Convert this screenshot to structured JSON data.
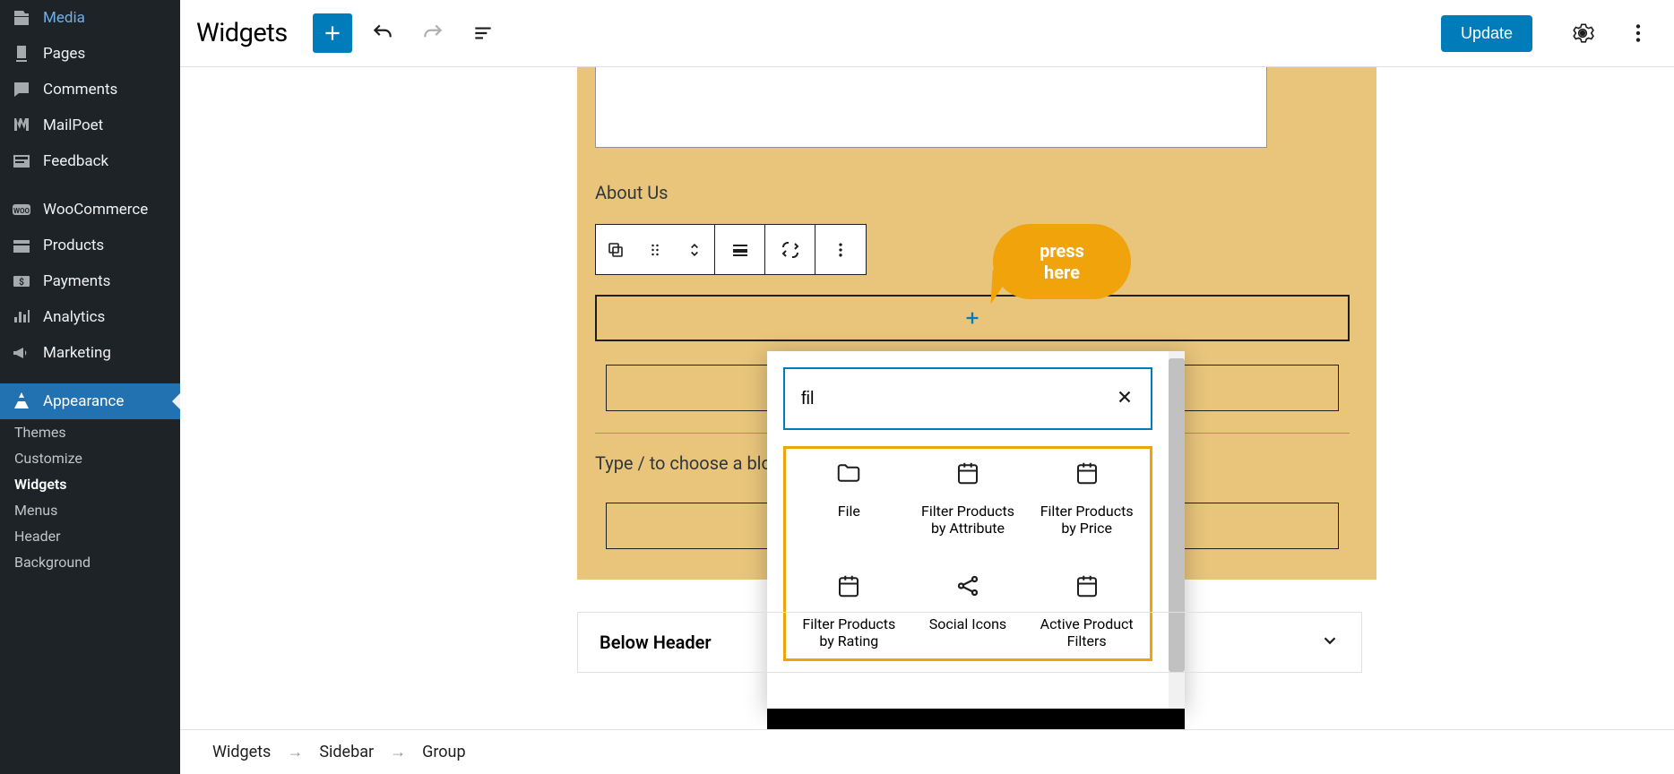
{
  "sidebar": {
    "items": [
      {
        "id": "media",
        "label": "Media",
        "icon": "media"
      },
      {
        "id": "pages",
        "label": "Pages",
        "icon": "pages"
      },
      {
        "id": "comments",
        "label": "Comments",
        "icon": "comments"
      },
      {
        "id": "mailpoet",
        "label": "MailPoet",
        "icon": "mailpoet"
      },
      {
        "id": "feedback",
        "label": "Feedback",
        "icon": "feedback"
      },
      {
        "id": "woocommerce",
        "label": "WooCommerce",
        "icon": "woo",
        "gap": true
      },
      {
        "id": "products",
        "label": "Products",
        "icon": "products"
      },
      {
        "id": "payments",
        "label": "Payments",
        "icon": "payments"
      },
      {
        "id": "analytics",
        "label": "Analytics",
        "icon": "analytics"
      },
      {
        "id": "marketing",
        "label": "Marketing",
        "icon": "marketing"
      },
      {
        "id": "appearance",
        "label": "Appearance",
        "icon": "appearance",
        "gap": true,
        "active": true
      }
    ],
    "sub": [
      {
        "id": "themes",
        "label": "Themes"
      },
      {
        "id": "customize",
        "label": "Customize"
      },
      {
        "id": "widgets",
        "label": "Widgets",
        "current": true
      },
      {
        "id": "menus",
        "label": "Menus"
      },
      {
        "id": "header",
        "label": "Header"
      },
      {
        "id": "background",
        "label": "Background"
      }
    ]
  },
  "topbar": {
    "title": "Widgets",
    "update_label": "Update"
  },
  "widget_area": {
    "about_label": "About Us",
    "type_prompt_prefix": "Type / to choose a blo"
  },
  "callout": {
    "line1": "press",
    "line2": "here"
  },
  "inserter": {
    "search_value": "fil",
    "blocks": [
      {
        "id": "file",
        "label": "File",
        "icon": "folder"
      },
      {
        "id": "filter-attr",
        "label": "Filter Products by Attribute",
        "icon": "calendar"
      },
      {
        "id": "filter-price",
        "label": "Filter Products by Price",
        "icon": "calendar"
      },
      {
        "id": "filter-rating",
        "label": "Filter Products by Rating",
        "icon": "calendar"
      },
      {
        "id": "social",
        "label": "Social Icons",
        "icon": "share"
      },
      {
        "id": "active-filters",
        "label": "Active Product Filters",
        "icon": "calendar"
      }
    ]
  },
  "panel_below": {
    "title": "Below Header"
  },
  "breadcrumb": [
    "Widgets",
    "Sidebar",
    "Group"
  ]
}
